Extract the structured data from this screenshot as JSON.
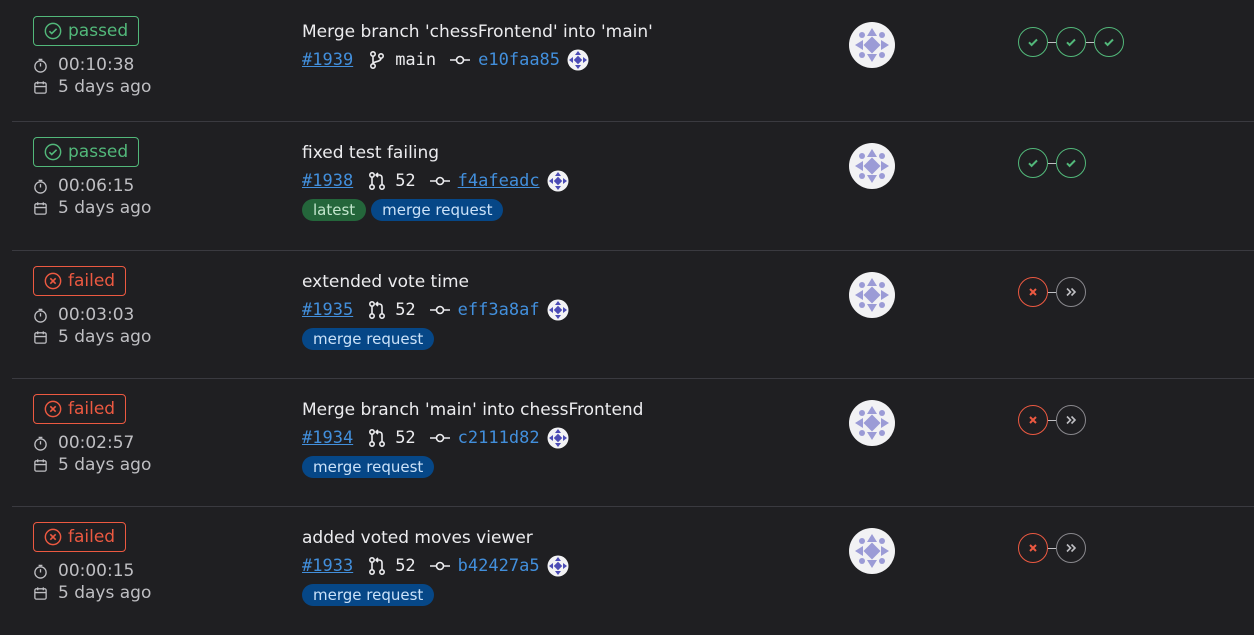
{
  "pipelines": [
    {
      "status": "passed",
      "duration": "00:10:38",
      "created": "5 days ago",
      "title": "Merge branch 'chessFrontend' into 'main'",
      "id": "#1939",
      "ref_type": "branch",
      "ref": "main",
      "sha": "e10faa85",
      "tags": [],
      "stages": [
        "ok",
        "ok",
        "ok"
      ]
    },
    {
      "status": "passed",
      "duration": "00:06:15",
      "created": "5 days ago",
      "title": "fixed test failing",
      "id": "#1938",
      "ref_type": "mr",
      "ref": "52",
      "sha": "f4afeadc",
      "tags": [
        {
          "label": "latest",
          "color": "green"
        },
        {
          "label": "merge request",
          "color": "blue"
        }
      ],
      "stages": [
        "ok",
        "ok"
      ]
    },
    {
      "status": "failed",
      "duration": "00:03:03",
      "created": "5 days ago",
      "title": "extended vote time",
      "id": "#1935",
      "ref_type": "mr",
      "ref": "52",
      "sha": "eff3a8af",
      "tags": [
        {
          "label": "merge request",
          "color": "blue"
        }
      ],
      "stages": [
        "bad",
        "skip"
      ]
    },
    {
      "status": "failed",
      "duration": "00:02:57",
      "created": "5 days ago",
      "title": "Merge branch 'main' into chessFrontend",
      "id": "#1934",
      "ref_type": "mr",
      "ref": "52",
      "sha": "c2111d82",
      "tags": [
        {
          "label": "merge request",
          "color": "blue"
        }
      ],
      "stages": [
        "bad",
        "skip"
      ]
    },
    {
      "status": "failed",
      "duration": "00:00:15",
      "created": "5 days ago",
      "title": "added voted moves viewer",
      "id": "#1933",
      "ref_type": "mr",
      "ref": "52",
      "sha": "b42427a5",
      "tags": [
        {
          "label": "merge request",
          "color": "blue"
        }
      ],
      "stages": [
        "bad",
        "skip"
      ]
    }
  ],
  "colors": {
    "passed": "#52b87a",
    "failed": "#ec5941",
    "link": "#428fdc"
  }
}
